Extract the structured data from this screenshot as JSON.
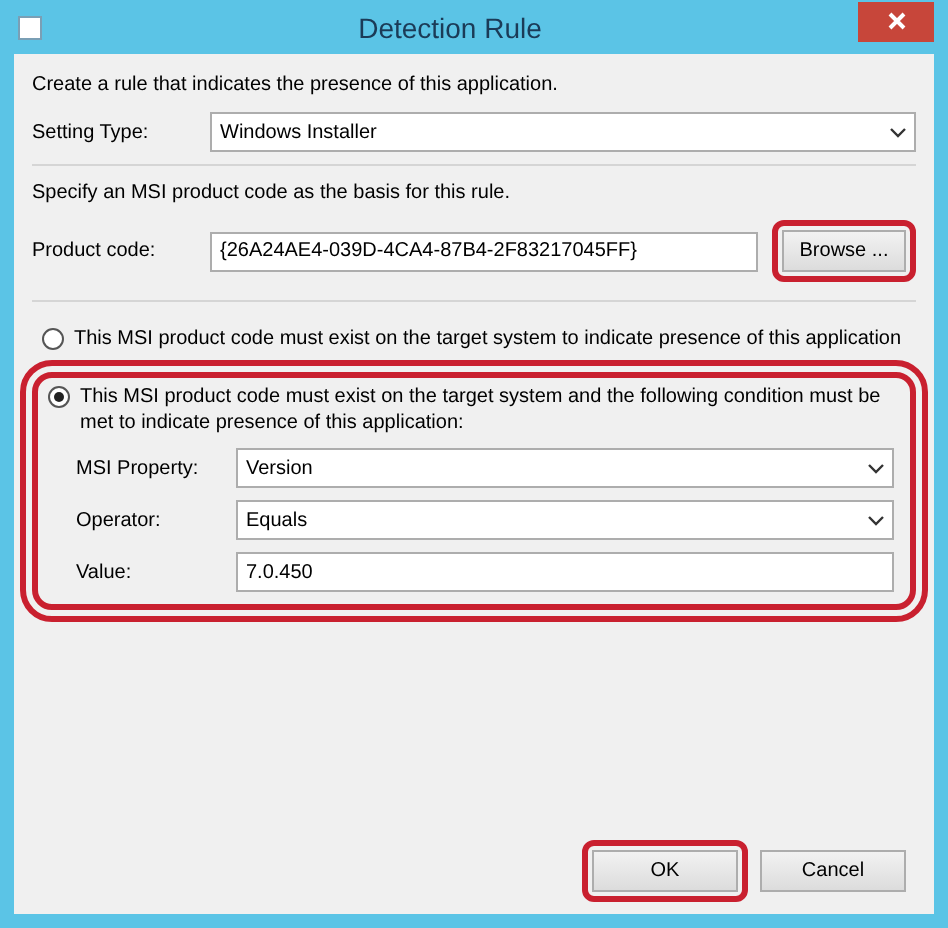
{
  "window": {
    "title": "Detection Rule"
  },
  "intro": "Create a rule that indicates the presence of this application.",
  "setting_type": {
    "label": "Setting Type:",
    "value": "Windows Installer"
  },
  "product_hint": "Specify an MSI product code as the basis for this rule.",
  "product_code": {
    "label": "Product code:",
    "value": "{26A24AE4-039D-4CA4-87B4-2F83217045FF}"
  },
  "browse_button": {
    "label": "Browse ...",
    "highlighted": true
  },
  "options": [
    {
      "label": "This MSI product code must exist on the target system to indicate presence of this application",
      "selected": false
    },
    {
      "label": "This MSI product code must exist on the target system and the following condition must be met to indicate presence of this application:",
      "selected": true,
      "highlighted": true,
      "fields": [
        {
          "kind": "dropdown",
          "label": "MSI Property:",
          "value": "Version"
        },
        {
          "kind": "dropdown",
          "label": "Operator:",
          "value": "Equals"
        },
        {
          "kind": "text",
          "label": "Value:",
          "value": "7.0.450"
        }
      ]
    }
  ],
  "buttons": [
    {
      "label": "OK",
      "highlighted": true
    },
    {
      "label": "Cancel"
    }
  ]
}
